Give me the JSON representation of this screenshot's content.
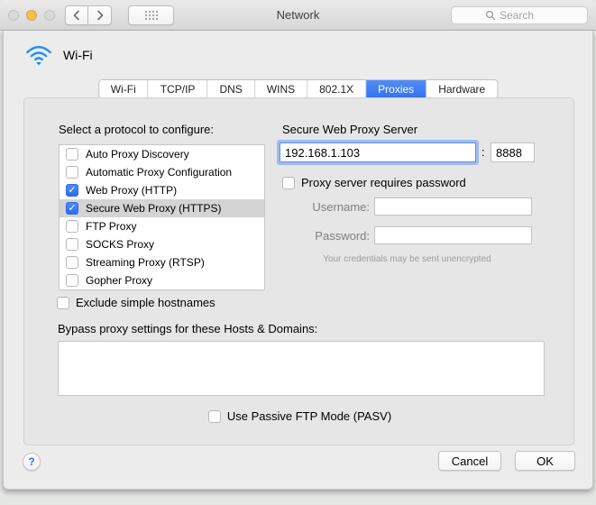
{
  "window": {
    "title": "Network"
  },
  "toolbar": {
    "search_placeholder": "Search",
    "icons": {
      "back": "chevron-left",
      "forward": "chevron-right",
      "show_all": "dot-grid",
      "search": "magnifier"
    }
  },
  "service": {
    "name": "Wi-Fi",
    "icon": "wifi"
  },
  "tabs": [
    {
      "label": "Wi-Fi",
      "selected": false
    },
    {
      "label": "TCP/IP",
      "selected": false
    },
    {
      "label": "DNS",
      "selected": false
    },
    {
      "label": "WINS",
      "selected": false
    },
    {
      "label": "802.1X",
      "selected": false
    },
    {
      "label": "Proxies",
      "selected": true
    },
    {
      "label": "Hardware",
      "selected": false
    }
  ],
  "protocols": {
    "label": "Select a protocol to configure:",
    "items": [
      {
        "label": "Auto Proxy Discovery",
        "checked": false,
        "selected": false
      },
      {
        "label": "Automatic Proxy Configuration",
        "checked": false,
        "selected": false
      },
      {
        "label": "Web Proxy (HTTP)",
        "checked": true,
        "selected": false
      },
      {
        "label": "Secure Web Proxy (HTTPS)",
        "checked": true,
        "selected": true
      },
      {
        "label": "FTP Proxy",
        "checked": false,
        "selected": false
      },
      {
        "label": "SOCKS Proxy",
        "checked": false,
        "selected": false
      },
      {
        "label": "Streaming Proxy (RTSP)",
        "checked": false,
        "selected": false
      },
      {
        "label": "Gopher Proxy",
        "checked": false,
        "selected": false
      }
    ]
  },
  "proxy_config": {
    "server_label": "Secure Web Proxy Server",
    "server_address": "192.168.1.103",
    "separator": ":",
    "port": "8888",
    "requires_password_label": "Proxy server requires password",
    "requires_password_checked": false,
    "username_label": "Username:",
    "username_value": "",
    "password_label": "Password:",
    "password_value": "",
    "credentials_note": "Your credentials may be sent unencrypted"
  },
  "options": {
    "exclude_hostnames_label": "Exclude simple hostnames",
    "exclude_hostnames_checked": false,
    "bypass_label": "Bypass proxy settings for these Hosts & Domains:",
    "bypass_value": "",
    "passive_ftp_label": "Use Passive FTP Mode (PASV)",
    "passive_ftp_checked": false
  },
  "footer": {
    "help_label": "?",
    "cancel_label": "Cancel",
    "ok_label": "OK"
  },
  "colors": {
    "accent_blue": "#3b7cf7",
    "tab_selected": "#3372f3",
    "row_highlight": "#d4d4d4",
    "sheet_bg": "#ececec",
    "focus_ring": "rgba(92,143,245,0.5)"
  }
}
